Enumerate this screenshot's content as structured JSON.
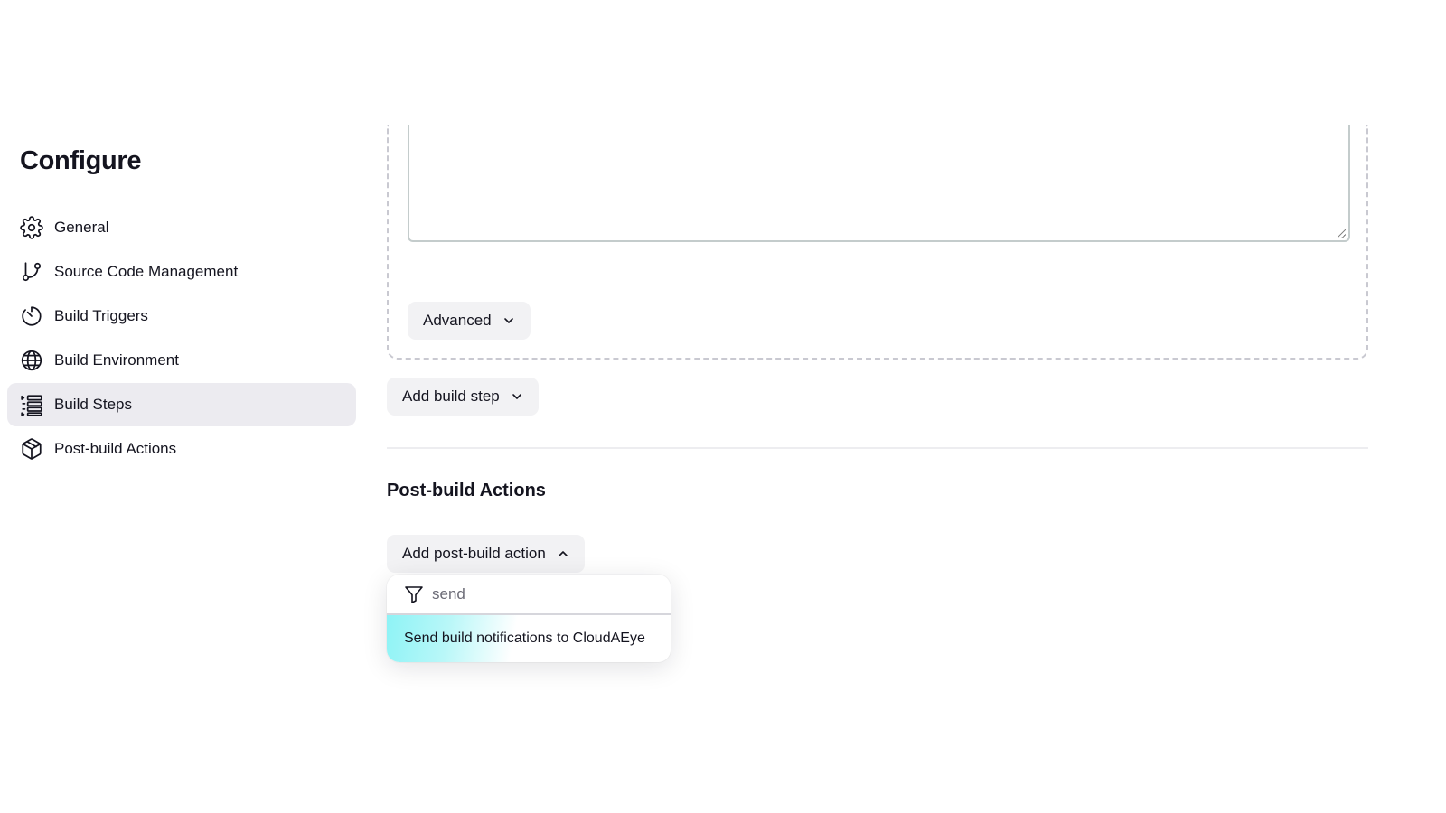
{
  "sidebar": {
    "title": "Configure",
    "items": [
      {
        "label": "General",
        "icon": "gear-icon"
      },
      {
        "label": "Source Code Management",
        "icon": "git-branch-icon"
      },
      {
        "label": "Build Triggers",
        "icon": "timer-icon"
      },
      {
        "label": "Build Environment",
        "icon": "globe-icon"
      },
      {
        "label": "Build Steps",
        "icon": "list-icon",
        "active": true
      },
      {
        "label": "Post-build Actions",
        "icon": "package-icon"
      }
    ]
  },
  "build_step": {
    "command_value": "",
    "advanced_label": "Advanced"
  },
  "add_build_step_label": "Add build step",
  "post_build": {
    "section_title": "Post-build Actions",
    "add_action_label": "Add post-build action",
    "filter": {
      "value": "send",
      "icon": "filter-icon"
    },
    "results": [
      {
        "label": "Send build notifications to CloudAEye"
      }
    ]
  },
  "colors": {
    "active_nav_bg": "#ecebf0",
    "button_bg": "#f2f2f4",
    "highlight": "#8ef3f6",
    "text": "#14141f"
  }
}
